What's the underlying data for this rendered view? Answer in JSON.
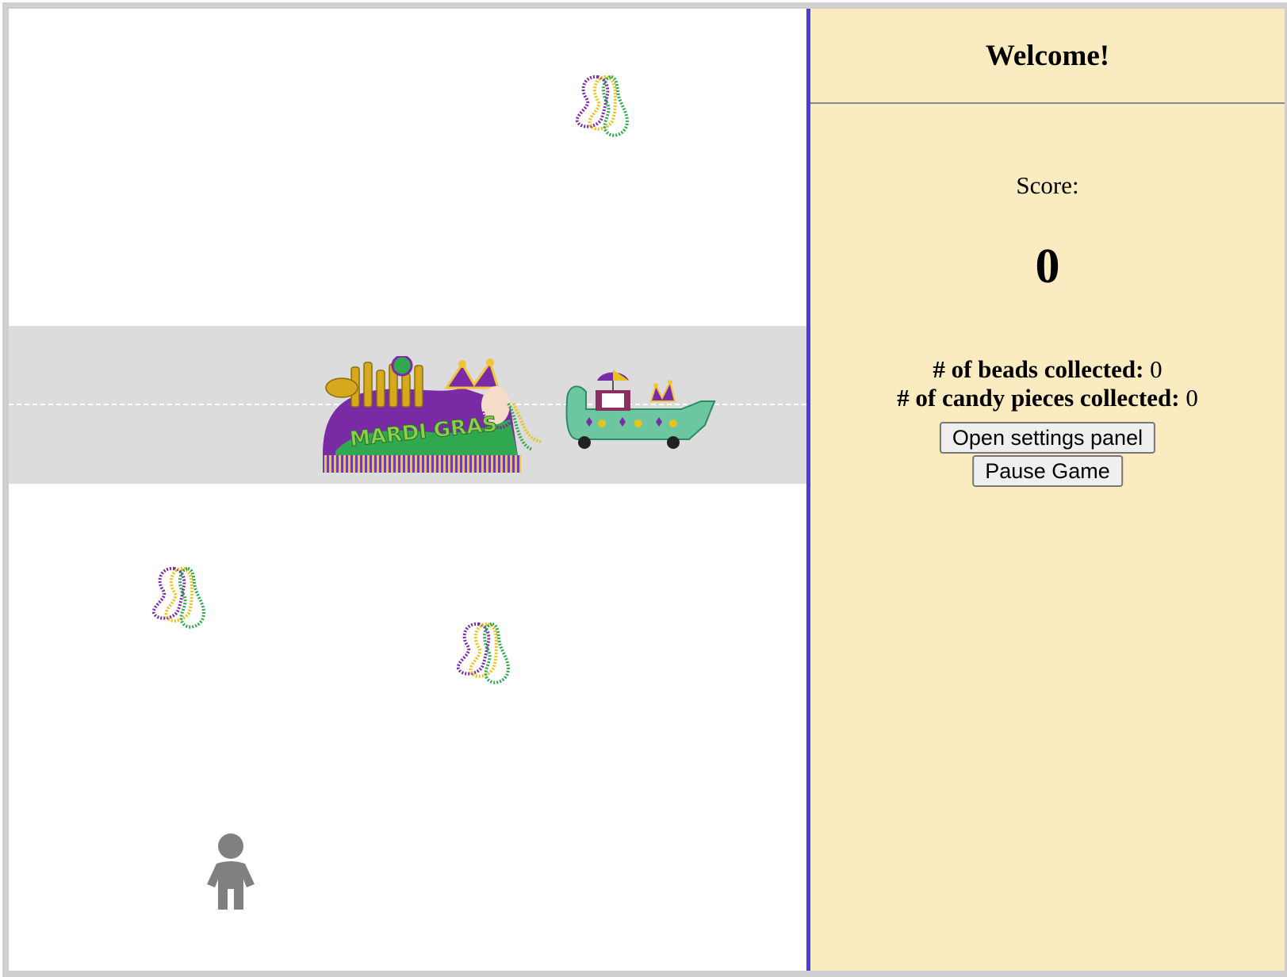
{
  "panel": {
    "welcome": "Welcome!",
    "score_label": "Score:",
    "score_value": "0",
    "beads_label": "# of beads collected:",
    "beads_value": "0",
    "candy_label": "# of candy pieces collected:",
    "candy_value": "0",
    "settings_button": "Open settings panel",
    "pause_button": "Pause Game"
  },
  "sprites": {
    "bead_icon": "bead-necklace-icon",
    "player_icon": "person-icon",
    "float_image": "mardi-gras-float",
    "float_logo_text": "MARDI GRAS",
    "car_image": "alligator-float-car"
  },
  "colors": {
    "purple": "#7b2aa6",
    "gold": "#e8c31a",
    "green": "#2fa84f",
    "divider": "#4a3ae0",
    "panel_bg": "#fbebc0",
    "street": "#dcdcdc",
    "player": "#808080"
  }
}
